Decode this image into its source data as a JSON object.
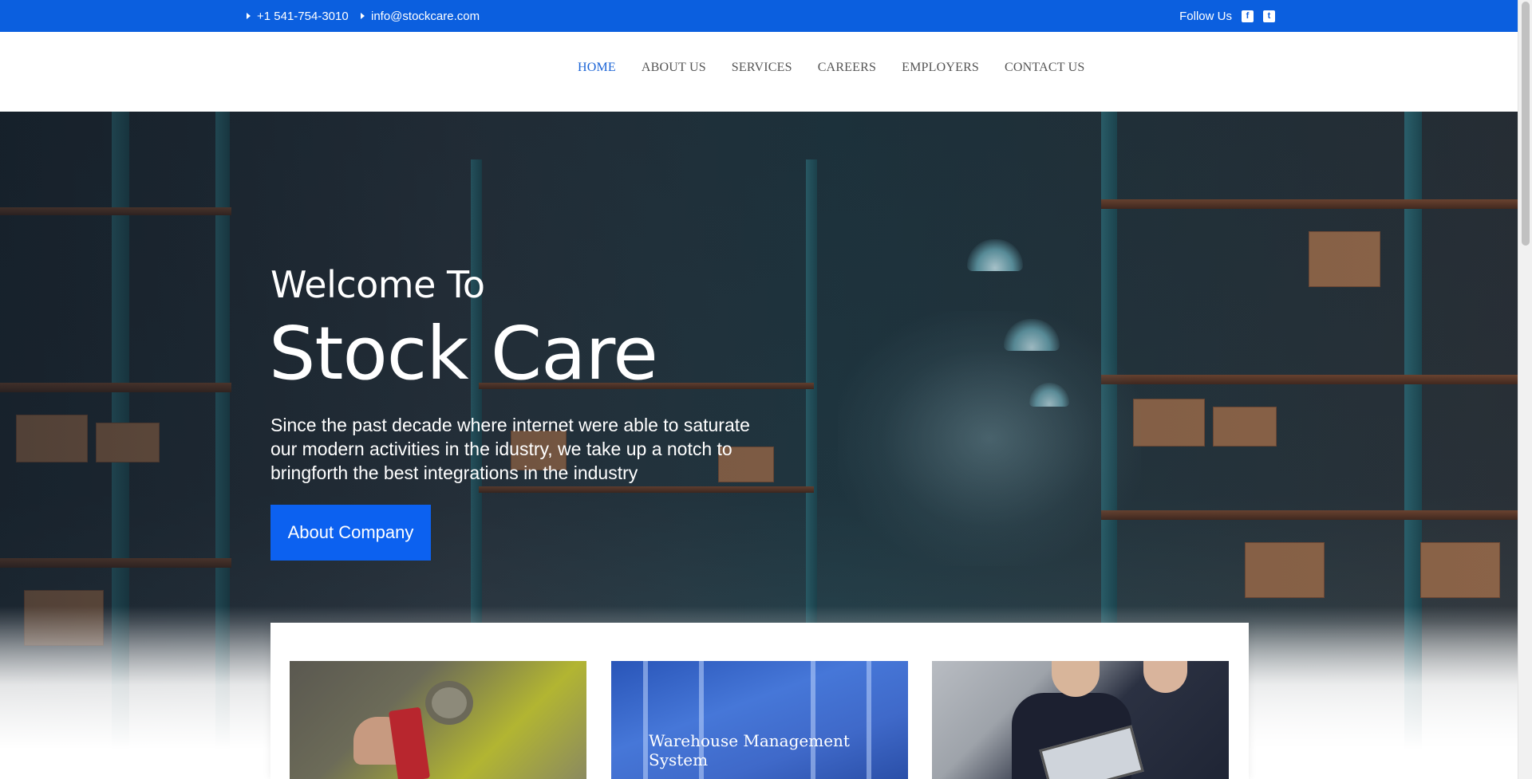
{
  "topbar": {
    "phone": "+1 541-754-3010",
    "email": "info@stockcare.com",
    "follow_label": "Follow Us",
    "socials": [
      {
        "name": "facebook-icon",
        "glyph": "f"
      },
      {
        "name": "twitter-icon",
        "glyph": "t"
      }
    ]
  },
  "nav": {
    "items": [
      {
        "label": "HOME",
        "active": true
      },
      {
        "label": "ABOUT US"
      },
      {
        "label": "SERVICES"
      },
      {
        "label": "CAREERS"
      },
      {
        "label": "EMPLOYERS"
      },
      {
        "label": "CONTACT US"
      }
    ]
  },
  "hero": {
    "welcome": "Welcome To",
    "brand": "Stock Care",
    "tagline": "Since the past decade where internet were able to saturate our modern activities in the idustry, we take up a notch to bringforth the best integrations in the industry",
    "cta_label": "About Company"
  },
  "cards": {
    "middle_title": "Warehouse Management System"
  },
  "colors": {
    "accent": "#0b5fdf",
    "button": "#0c61f0",
    "nav_active": "#1a63d6"
  }
}
